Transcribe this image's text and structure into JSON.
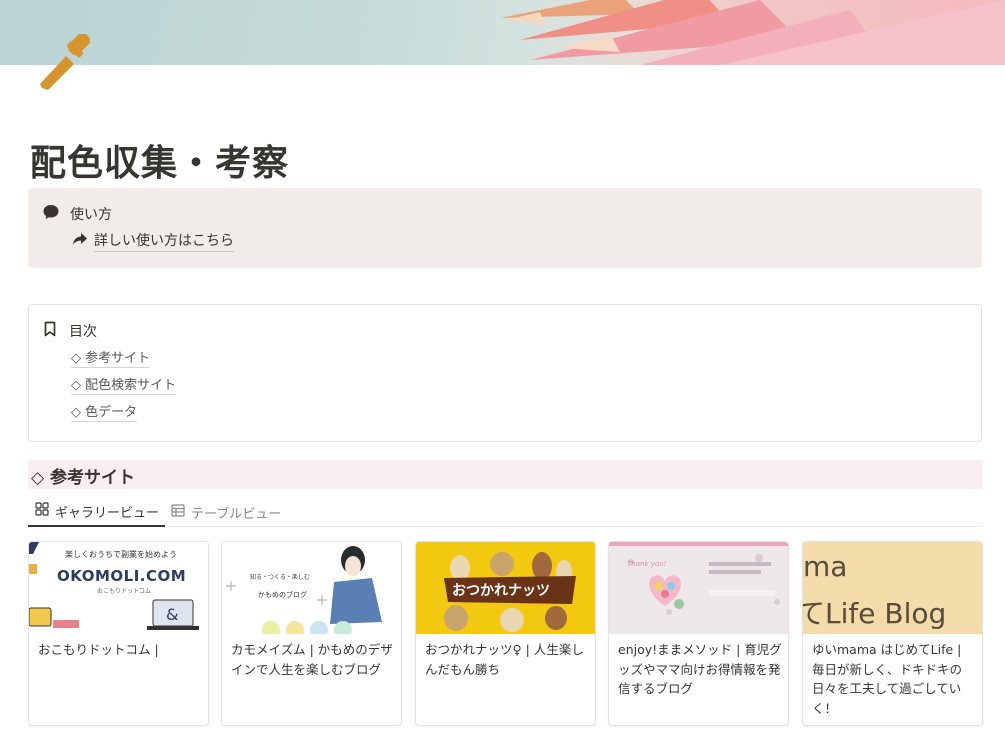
{
  "page": {
    "title": "配色収集・考察",
    "icon": "eyedropper-icon"
  },
  "callout": {
    "icon": "speech-bubble-icon",
    "title": "使い方",
    "link_icon": "share-arrow-icon",
    "link_text": "詳しい使い方はこちら"
  },
  "toc": {
    "icon": "bookmark-icon",
    "title": "目次",
    "items": [
      "◇ 参考サイト",
      "◇ 配色検索サイト",
      "◇ 色データ"
    ]
  },
  "section": {
    "title": "◇ 参考サイト"
  },
  "tabs": [
    {
      "label": "ギャラリービュー",
      "icon": "gallery-grid-icon",
      "active": true
    },
    {
      "label": "テーブルビュー",
      "icon": "table-icon",
      "active": false
    }
  ],
  "cards": [
    {
      "caption": "おこもりドットコム |",
      "thumb": {
        "top_text": "楽しくおうちで副業を始めよう",
        "logo": "OKOMOLI.COM",
        "sub": "おこもりドットコム"
      }
    },
    {
      "caption": "カモメイズム | かもめのデザインで人生を楽しむブログ",
      "thumb": {
        "tagline": "知る・つくる・楽しむ",
        "title": "かもめのブログ"
      }
    },
    {
      "caption": "おつかれナッツ♀ | 人生楽しんだもん勝ち",
      "thumb": {
        "title": "おつかれナッツ"
      }
    },
    {
      "caption": "enjoy!ままメソッド | 育児グッズやママ向けお得情報を発信するブログ",
      "thumb": {
        "text": "Thank you!"
      }
    },
    {
      "caption": "ゆいmama はじめてLife | 毎日が新しく、ドキドキの日々を工夫して過ごしていく！",
      "thumb": {
        "line1": "ma",
        "line2": "てLife Blog"
      }
    }
  ],
  "colors": {
    "callout_bg": "#f1ecea",
    "section_bg": "#fbeef2",
    "text": "#37352f",
    "muted": "#8a8884",
    "nut_yellow": "#f2c811"
  }
}
